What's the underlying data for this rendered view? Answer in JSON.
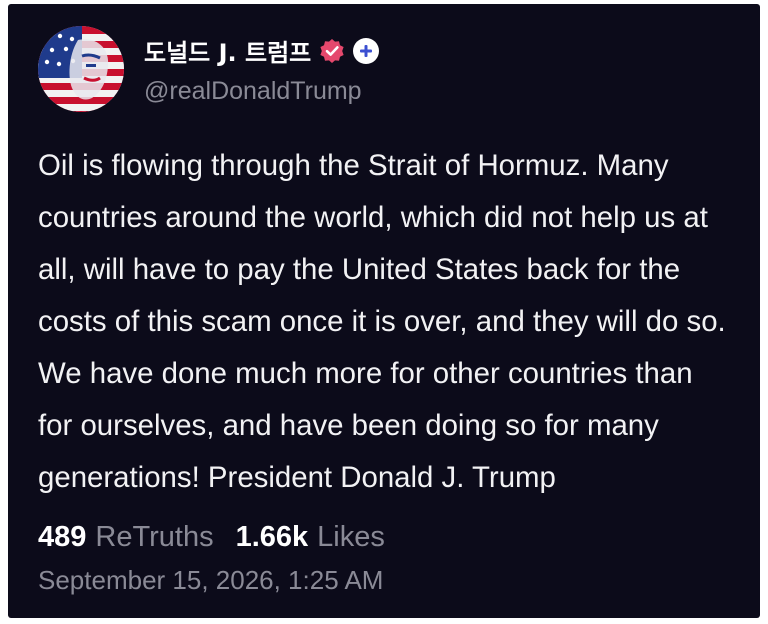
{
  "post": {
    "author": {
      "display_name": "도널드 J. 트럼프",
      "handle": "@realDonaldTrump",
      "avatar_icon": "avatar-flag-portrait",
      "verified_icon": "verified-badge-icon",
      "follow_icon": "plus-icon"
    },
    "text": "Oil is flowing through the Strait of Hormuz. Many\ncountries around the world, which did not help us at\nall, will have to pay the United States back for the\ncosts of this scam once it is over, and they will do so.\nWe have done much more for other countries than\nfor ourselves, and have been doing so for many\ngenerations! President Donald J. Trump",
    "stats": {
      "retruths_count": "489",
      "retruths_label": "ReTruths",
      "likes_count": "1.66k",
      "likes_label": "Likes"
    },
    "timestamp": "September 15, 2026, 1:25 AM"
  },
  "colors": {
    "background": "#0c0b1a",
    "text_primary": "#ffffff",
    "text_secondary": "#8a8a96",
    "badge": "#e5486d",
    "plus_icon": "#3b4fd1"
  }
}
